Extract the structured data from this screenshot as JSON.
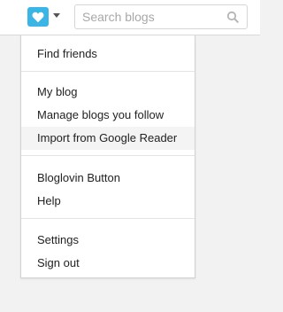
{
  "colors": {
    "accent": "#3ab5e6",
    "page_background": "#f2f2f2",
    "highlight": "#f4f4f4"
  },
  "header": {
    "logo_icon": "heart-icon",
    "menu_toggle_icon": "caret-down-icon",
    "search": {
      "placeholder": "Search blogs",
      "value": "",
      "icon": "magnifier-icon"
    }
  },
  "menu": {
    "items": [
      {
        "label": "Find friends",
        "highlighted": false
      },
      {
        "label": "My blog",
        "highlighted": false
      },
      {
        "label": "Manage blogs you follow",
        "highlighted": false
      },
      {
        "label": "Import from Google Reader",
        "highlighted": true
      },
      {
        "label": "Bloglovin Button",
        "highlighted": false
      },
      {
        "label": "Help",
        "highlighted": false
      },
      {
        "label": "Settings",
        "highlighted": false
      },
      {
        "label": "Sign out",
        "highlighted": false
      }
    ]
  }
}
